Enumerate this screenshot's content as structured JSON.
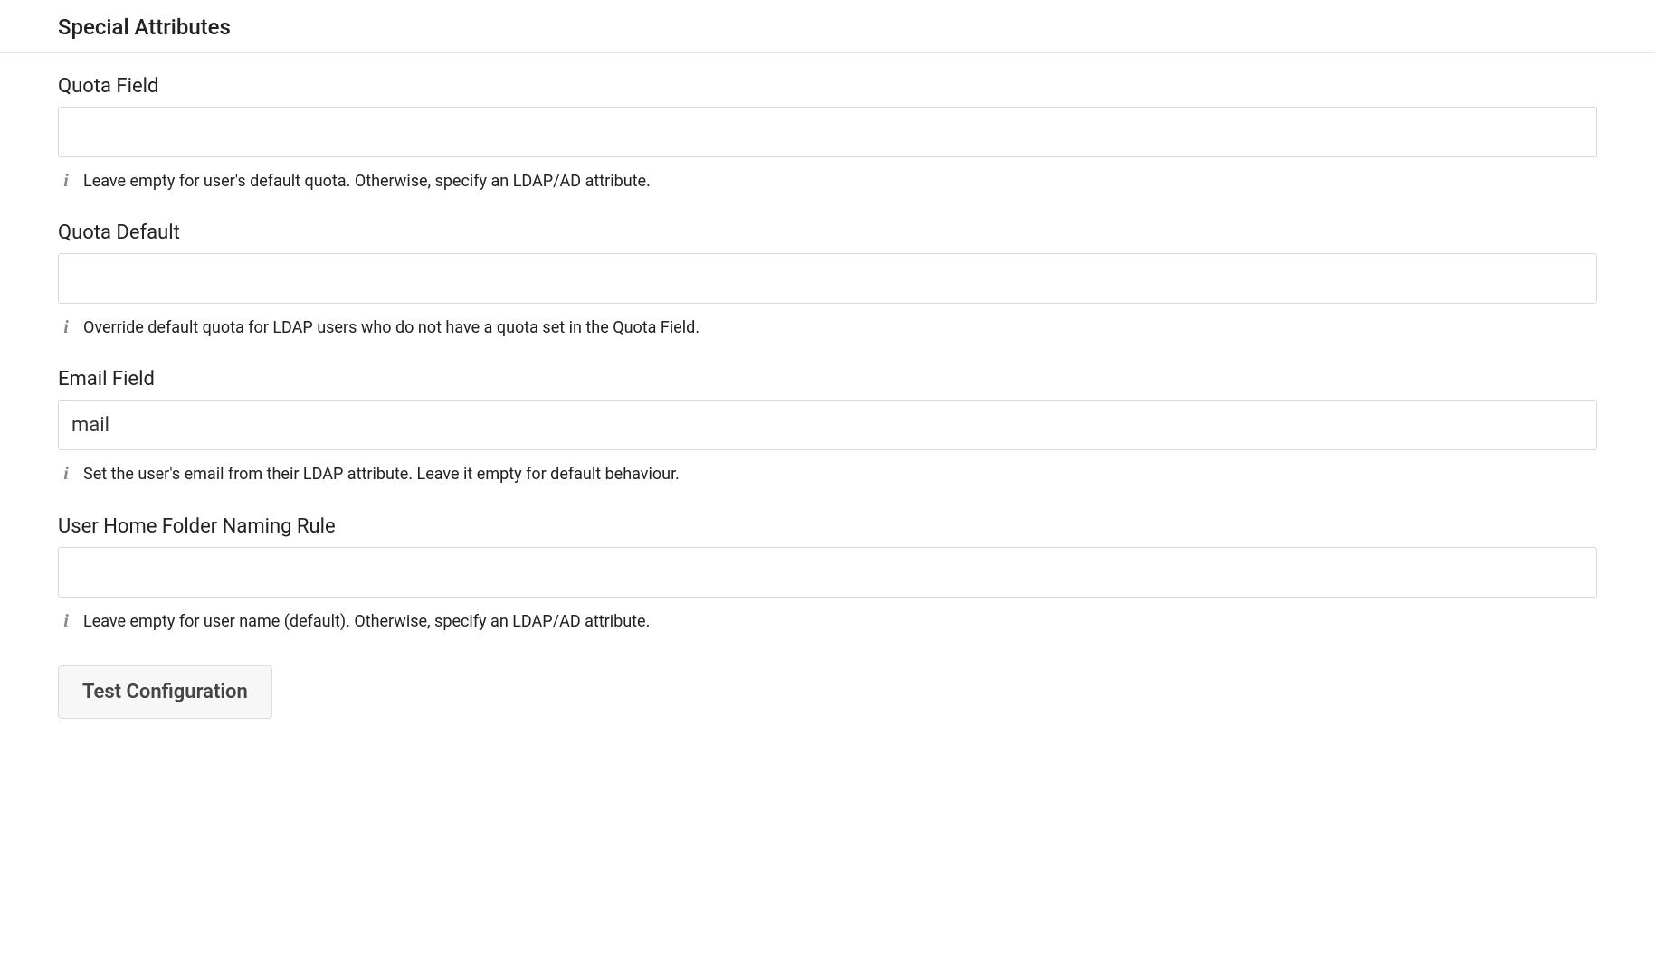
{
  "section": {
    "title": "Special Attributes"
  },
  "fields": {
    "quota_field": {
      "label": "Quota Field",
      "value": "",
      "hint": "Leave empty for user's default quota. Otherwise, specify an LDAP/AD attribute."
    },
    "quota_default": {
      "label": "Quota Default",
      "value": "",
      "hint": "Override default quota for LDAP users who do not have a quota set in the Quota Field."
    },
    "email_field": {
      "label": "Email Field",
      "value": "mail",
      "hint": "Set the user's email from their LDAP attribute. Leave it empty for default behaviour."
    },
    "home_folder_rule": {
      "label": "User Home Folder Naming Rule",
      "value": "",
      "hint": "Leave empty for user name (default). Otherwise, specify an LDAP/AD attribute."
    }
  },
  "actions": {
    "test_configuration": "Test Configuration"
  }
}
